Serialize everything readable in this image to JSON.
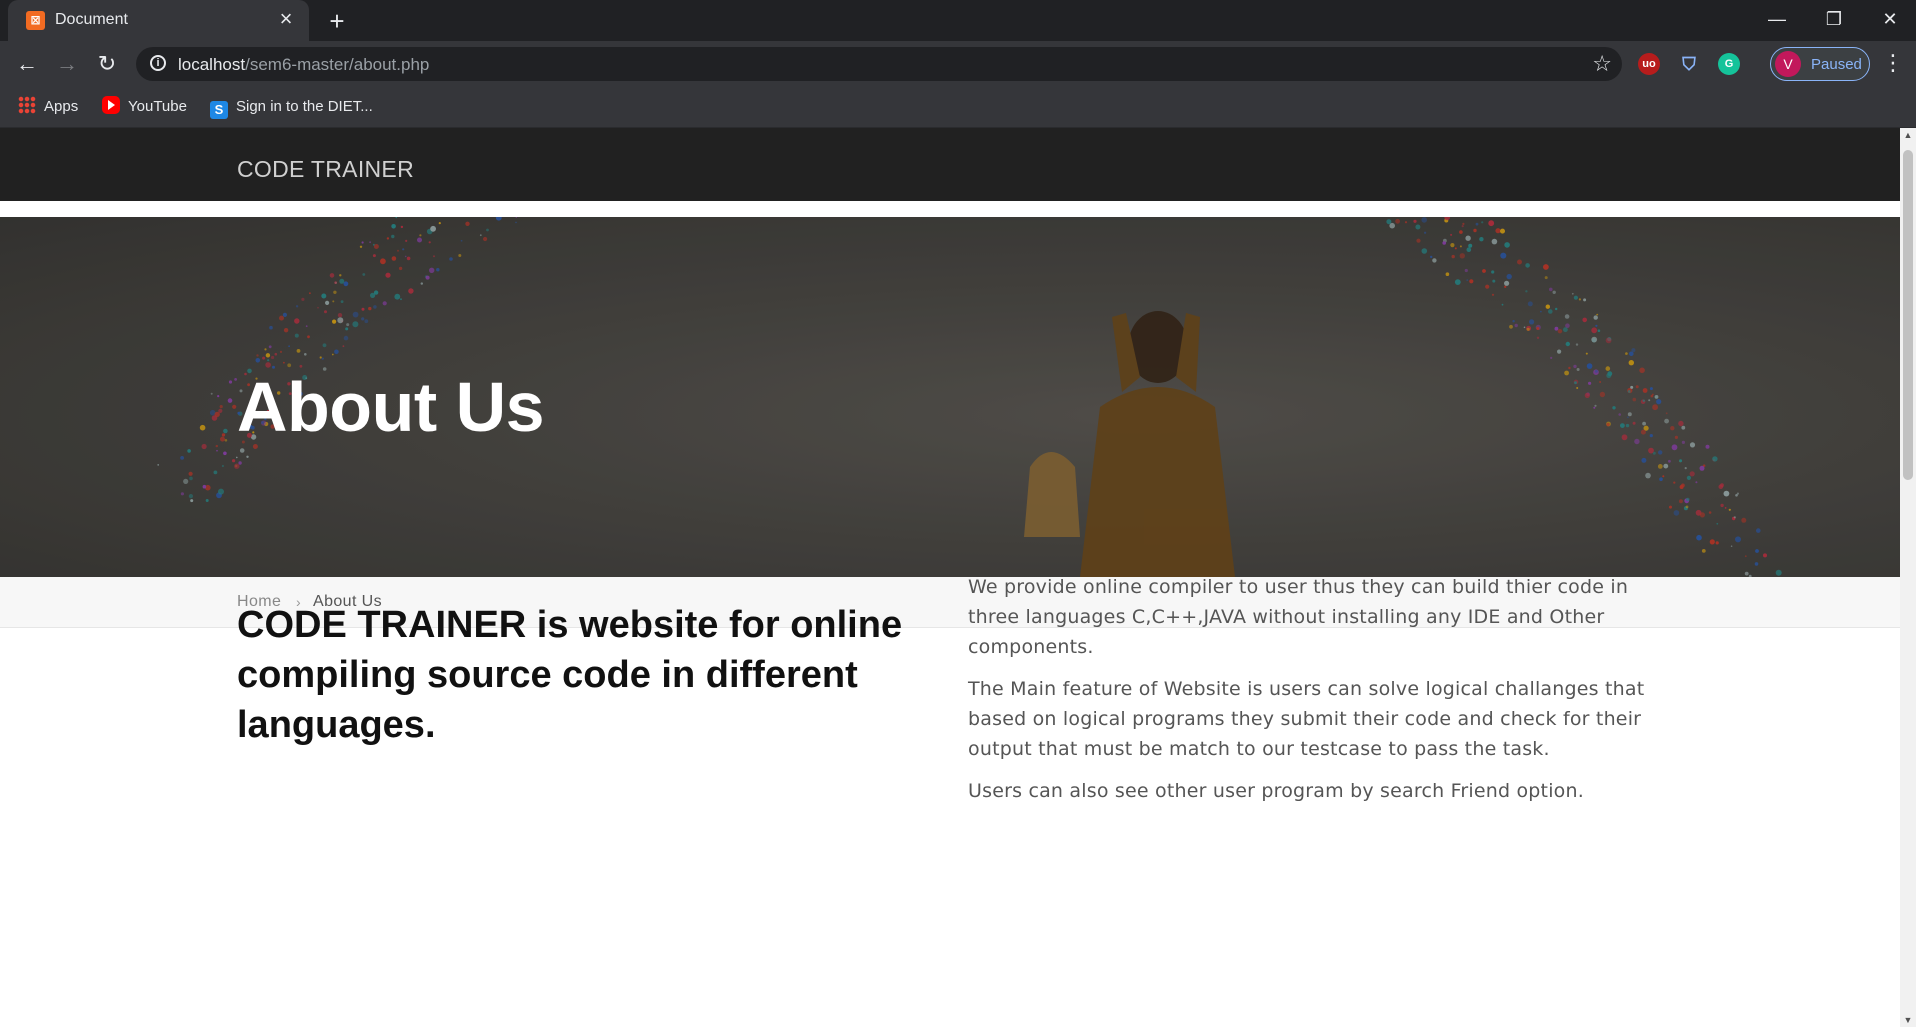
{
  "browser": {
    "tab_title": "Document",
    "url_host": "localhost",
    "url_path": "/sem6-master/about.php",
    "profile_initial": "V",
    "profile_status": "Paused",
    "bookmarks": [
      {
        "label": "Apps",
        "icon": "apps-grid-icon"
      },
      {
        "label": "YouTube",
        "icon": "youtube-icon"
      },
      {
        "label": "Sign in to the DIET...",
        "icon": "s-logo-icon"
      }
    ],
    "colors": {
      "chrome_dark": "#202124",
      "chrome_toolbar": "#35363a",
      "profile_accent": "#8ab4f8"
    }
  },
  "site": {
    "brand": "CODE TRAINER",
    "hero_title": "About Us",
    "breadcrumb": {
      "home": "Home",
      "separator": "›",
      "current": "About Us"
    },
    "lead": "CODE TRAINER is website for online compiling source code in different languages.",
    "paragraphs": [
      "We provide online compiler to user thus they can build thier code in three languages C,C++,JAVA without installing any IDE and Other components.",
      "The Main feature of Website is users can solve logical challanges that based on logical programs they submit their code and check for their output that must be match to our testcase to pass the task.",
      "Users can also see other user program by search Friend option."
    ],
    "colors": {
      "navbar": "#212121",
      "hero_overlay": "#4a4844",
      "breadcrumb_bg": "#f7f7f7"
    }
  }
}
